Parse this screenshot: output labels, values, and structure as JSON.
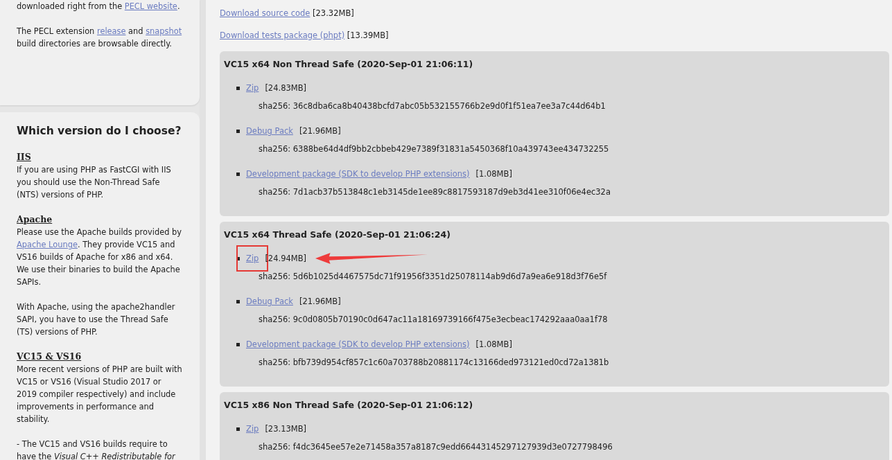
{
  "sidebar": [
    {
      "paragraphs": [
        [
          {
            "text": "downloaded right from the "
          },
          {
            "link": "PECL website"
          },
          {
            "text": "."
          }
        ],
        [
          {
            "text": "The PECL extension "
          },
          {
            "link": "release"
          },
          {
            "text": " and "
          },
          {
            "link": "snapshot"
          },
          {
            "text": " build directories are browsable directly."
          }
        ]
      ]
    },
    {
      "title": "Which version do I choose?",
      "sections": [
        {
          "heading": "IIS",
          "paragraphs": [
            [
              {
                "text": "If you are using PHP as FastCGI with IIS you should use the Non-Thread Safe (NTS) versions of PHP."
              }
            ]
          ]
        },
        {
          "heading": "Apache",
          "paragraphs": [
            [
              {
                "text": "Please use the Apache builds provided by "
              },
              {
                "link": "Apache Lounge"
              },
              {
                "text": ". They provide VC15 and VS16 builds of Apache for x86 and x64. We use their binaries to build the Apache SAPIs."
              }
            ],
            [
              {
                "text": "With Apache, using the apache2handler SAPI, you have to use the Thread Safe (TS) versions of PHP."
              }
            ]
          ]
        },
        {
          "heading": "VC15 & VS16",
          "paragraphs": [
            [
              {
                "text": "More recent versions of PHP are built with VC15 or VS16 (Visual Studio 2017 or 2019 compiler respectively) and include improvements in performance and stability."
              }
            ],
            [
              {
                "rich": "- The VC15 and VS16 builds require to have the *Visual C++ Redistributable for*"
              }
            ]
          ]
        }
      ]
    }
  ],
  "downloads": [
    {
      "link": "Download source code",
      "size": "[23.32MB]"
    },
    {
      "link": "Download tests package (phpt)",
      "size": "[13.39MB]"
    }
  ],
  "builds": [
    {
      "title": "VC15 x64 Non Thread Safe (2020-Sep-01 21:06:11)",
      "items": [
        {
          "link": "Zip",
          "size": "[24.83MB]",
          "sha": "sha256: 36c8dba6ca8b40438bcfd7abc05b532155766b2e9d0f1f51ea7ee3a7c44d64b1",
          "highlighted": false
        },
        {
          "link": "Debug Pack",
          "size": "[21.96MB]",
          "sha": "sha256: 6388be64d4df9bb2cbbeb429e7389f31831a5450368f10a439743ee434732255",
          "highlighted": false
        },
        {
          "link": "Development package (SDK to develop PHP extensions)",
          "size": "[1.08MB]",
          "sha": "sha256: 7d1acb37b513848c1eb3145de1ee89c8817593187d9eb3d41ee310f06e4ec32a",
          "highlighted": false
        }
      ]
    },
    {
      "title": "VC15 x64 Thread Safe (2020-Sep-01 21:06:24)",
      "items": [
        {
          "link": "Zip",
          "size": "[24.94MB]",
          "sha": "sha256: 5d6b1025d4467575dc71f91956f3351d25078114ab9d6d7a9ea6e918d3f76e5f",
          "highlighted": true
        },
        {
          "link": "Debug Pack",
          "size": "[21.96MB]",
          "sha": "sha256: 9c0d0805b70190c0d647ac11a18169739166f475e3ecbeac174292aaa0aa1f78",
          "highlighted": false
        },
        {
          "link": "Development package (SDK to develop PHP extensions)",
          "size": "[1.08MB]",
          "sha": "sha256: bfb739d954cf857c1c60a703788b20881174c13166ded973121ed0cd72a1381b",
          "highlighted": false
        }
      ]
    },
    {
      "title": "VC15 x86 Non Thread Safe (2020-Sep-01 21:06:12)",
      "items": [
        {
          "link": "Zip",
          "size": "[23.13MB]",
          "sha": "sha256: f4dc3645ee57e2e71458a357a8187c9edd66443145297127939d3e0727798496",
          "highlighted": false
        }
      ]
    }
  ]
}
